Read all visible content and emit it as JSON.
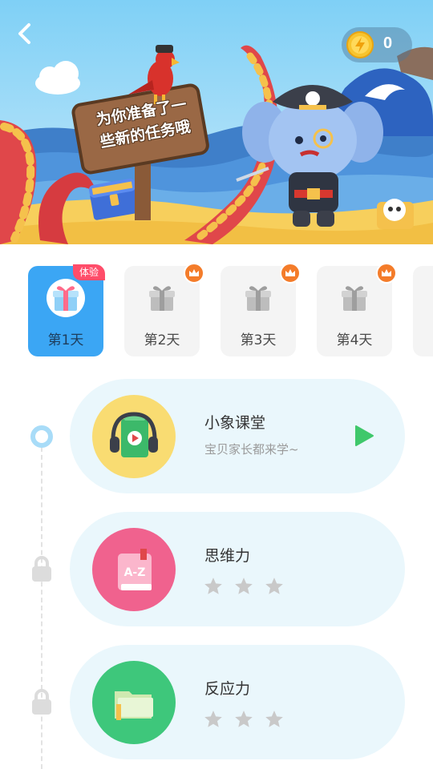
{
  "header": {
    "back_icon": "chevron-left-icon",
    "coins": "0",
    "coin_icon": "lightning-coin-icon",
    "sign_line1": "为你准备了一",
    "sign_line2": "些新的任务哦"
  },
  "days": [
    {
      "label": "第1天",
      "badge": "体验",
      "active": true
    },
    {
      "label": "第2天",
      "badge_icon": "crown-icon"
    },
    {
      "label": "第3天",
      "badge_icon": "crown-icon"
    },
    {
      "label": "第4天",
      "badge_icon": "crown-icon"
    }
  ],
  "lessons": [
    {
      "title": "小象课堂",
      "subtitle": "宝贝家长都来学~",
      "icon": "headphone-book-icon",
      "status": "unlocked",
      "action_icon": "play-icon"
    },
    {
      "title": "思维力",
      "icon": "az-book-icon",
      "status": "locked",
      "stars": 3
    },
    {
      "title": "反应力",
      "icon": "folder-icon",
      "status": "locked",
      "stars": 3
    }
  ],
  "colors": {
    "accent_blue": "#3ba6f4",
    "card_bg": "#eaf7fc",
    "play_green": "#3fc86b",
    "crown_orange": "#f47c2a",
    "trial_pink": "#ff4d6a"
  }
}
